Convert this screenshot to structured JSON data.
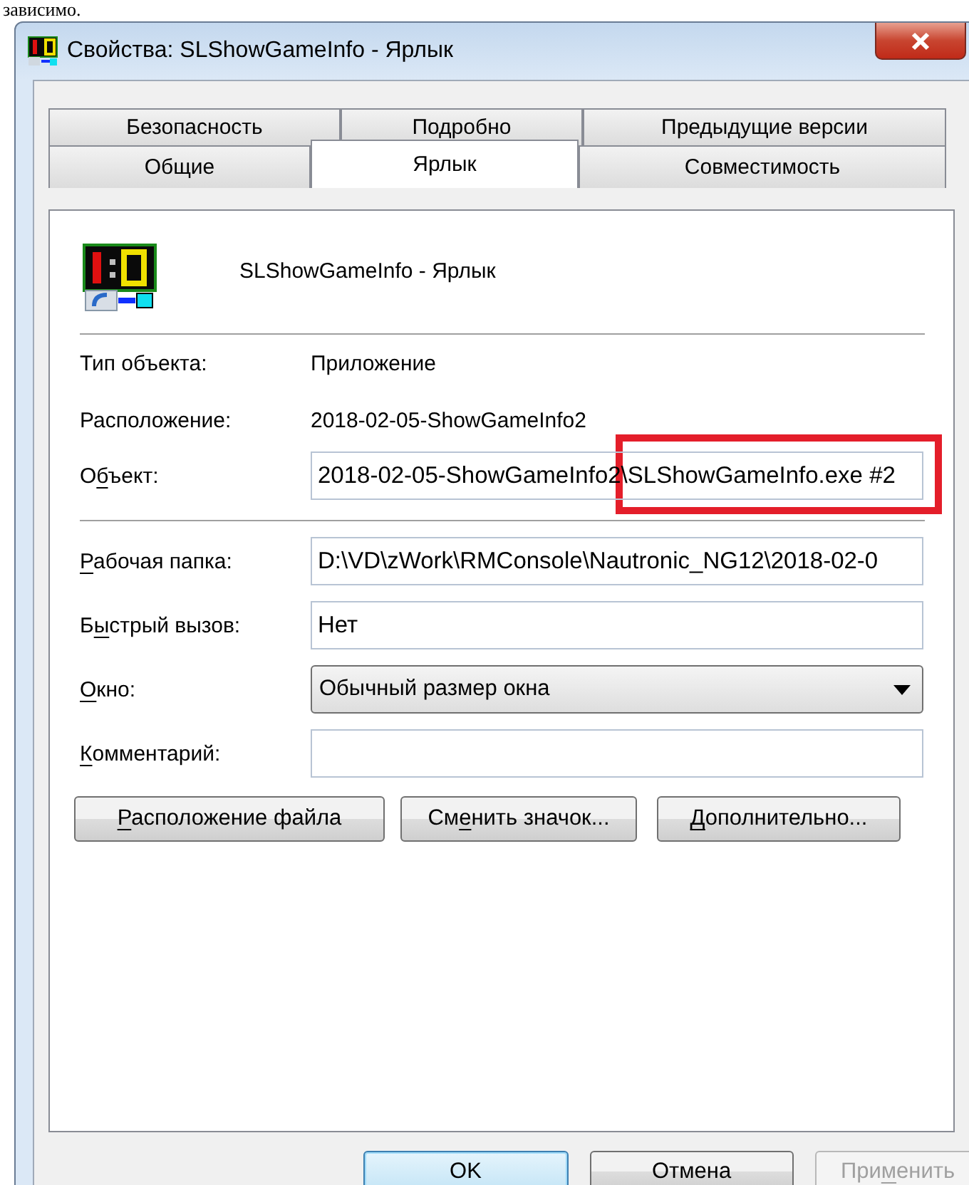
{
  "page_text": "зависимо.",
  "window": {
    "title": "Свойства: SLShowGameInfo - Ярлык"
  },
  "tab_rows": [
    [
      {
        "label": "Безопасность",
        "selected": false
      },
      {
        "label": "Подробно",
        "selected": false
      },
      {
        "label": "Предыдущие версии",
        "selected": false
      }
    ],
    [
      {
        "label": "Общие",
        "selected": false
      },
      {
        "label": "Ярлык",
        "selected": true
      },
      {
        "label": "Совместимость",
        "selected": false
      }
    ]
  ],
  "header": {
    "name": "SLShowGameInfo - Ярлык"
  },
  "info": [
    {
      "label": "Тип объекта:",
      "value": "Приложение"
    },
    {
      "label": "Расположение:",
      "value": "2018-02-05-ShowGameInfo2"
    }
  ],
  "object_field": {
    "label": [
      {
        "text": "О",
        "key": false
      },
      {
        "text": "б",
        "key": true
      },
      {
        "text": "ъект:",
        "key": false
      }
    ],
    "value": "2018-02-05-ShowGameInfo2\\SLShowGameInfo.exe #2",
    "highlighted": true
  },
  "fields": [
    {
      "kind": "text",
      "label": [
        {
          "text": "Р",
          "key": true
        },
        {
          "text": "абочая папка:",
          "key": false
        }
      ],
      "value": "D:\\VD\\zWork\\RMConsole\\Nautronic_NG12\\2018-02-0"
    },
    {
      "kind": "text",
      "label": [
        {
          "text": "Б",
          "key": false
        },
        {
          "text": "ы",
          "key": true
        },
        {
          "text": "стрый вызов:",
          "key": false
        }
      ],
      "value": "Нет"
    },
    {
      "kind": "select",
      "label": [
        {
          "text": "О",
          "key": true
        },
        {
          "text": "кно:",
          "key": false
        }
      ],
      "value": "Обычный размер окна"
    },
    {
      "kind": "text",
      "label": [
        {
          "text": "К",
          "key": true
        },
        {
          "text": "омментарий:",
          "key": false
        }
      ]
    }
  ],
  "actions": [
    {
      "label": [
        {
          "text": "Р",
          "key": true
        },
        {
          "text": "асположение файла",
          "key": false
        }
      ]
    },
    {
      "label": [
        {
          "text": "См",
          "key": false
        },
        {
          "text": "е",
          "key": true
        },
        {
          "text": "нить значок...",
          "key": false
        }
      ]
    },
    {
      "label": [
        {
          "text": "Д",
          "key": true
        },
        {
          "text": "ополнительно...",
          "key": false
        }
      ]
    }
  ],
  "buttons": [
    {
      "label": [
        {
          "text": "OK",
          "key": false
        }
      ],
      "default": true,
      "disabled": false
    },
    {
      "label": [
        {
          "text": "Отмена",
          "key": false
        }
      ],
      "default": false,
      "disabled": false
    },
    {
      "label": [
        {
          "text": "При",
          "key": false
        },
        {
          "text": "м",
          "key": true
        },
        {
          "text": "енить",
          "key": false
        }
      ],
      "default": false,
      "disabled": true
    }
  ]
}
